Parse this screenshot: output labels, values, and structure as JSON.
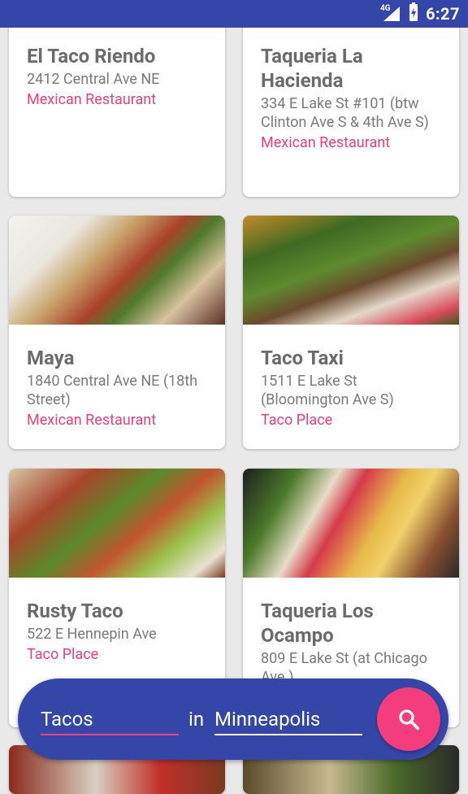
{
  "status": {
    "network": "4G",
    "time": "6:27"
  },
  "restaurants": [
    {
      "name": "El Taco Riendo",
      "address": "2412 Central Ave NE",
      "category": "Mexican Restaurant"
    },
    {
      "name": "Taqueria La Hacienda",
      "address": "334 E Lake St #101 (btw Clinton Ave S & 4th Ave S)",
      "category": "Mexican Restaurant"
    },
    {
      "name": "Maya",
      "address": "1840 Central Ave NE (18th Street)",
      "category": "Mexican Restaurant"
    },
    {
      "name": "Taco Taxi",
      "address": "1511 E Lake St (Bloomington Ave S)",
      "category": "Taco Place"
    },
    {
      "name": "Rusty Taco",
      "address": "522 E Hennepin Ave",
      "category": "Taco Place"
    },
    {
      "name": "Taqueria Los Ocampo",
      "address": "809 E Lake St (at Chicago Ave.)",
      "category": ""
    }
  ],
  "search": {
    "query": "Tacos",
    "connector": "in",
    "location": "Minneapolis"
  },
  "colors": {
    "primary": "#3446a8",
    "accent": "#f43d7d",
    "category_text": "#e8407a"
  }
}
